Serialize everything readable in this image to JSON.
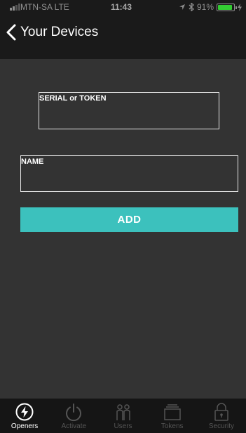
{
  "status_bar": {
    "carrier": "MTN-SA  LTE",
    "time": "11:43",
    "battery_text": "91%",
    "battery_level": 0.91,
    "battery_color": "#33cc33"
  },
  "nav": {
    "back_icon": "chevron-left-icon",
    "title": "Your Devices"
  },
  "form": {
    "serial_label": "SERIAL or TOKEN",
    "serial_value": "",
    "name_label": "NAME",
    "name_value": "",
    "add_label": "ADD",
    "accent_color": "#3cc1bd"
  },
  "tabs": [
    {
      "label": "Openers",
      "icon": "bolt-icon",
      "active": true
    },
    {
      "label": "Activate",
      "icon": "power-icon",
      "active": false
    },
    {
      "label": "Users",
      "icon": "users-icon",
      "active": false
    },
    {
      "label": "Tokens",
      "icon": "tokens-icon",
      "active": false
    },
    {
      "label": "Security",
      "icon": "lock-icon",
      "active": false
    }
  ]
}
